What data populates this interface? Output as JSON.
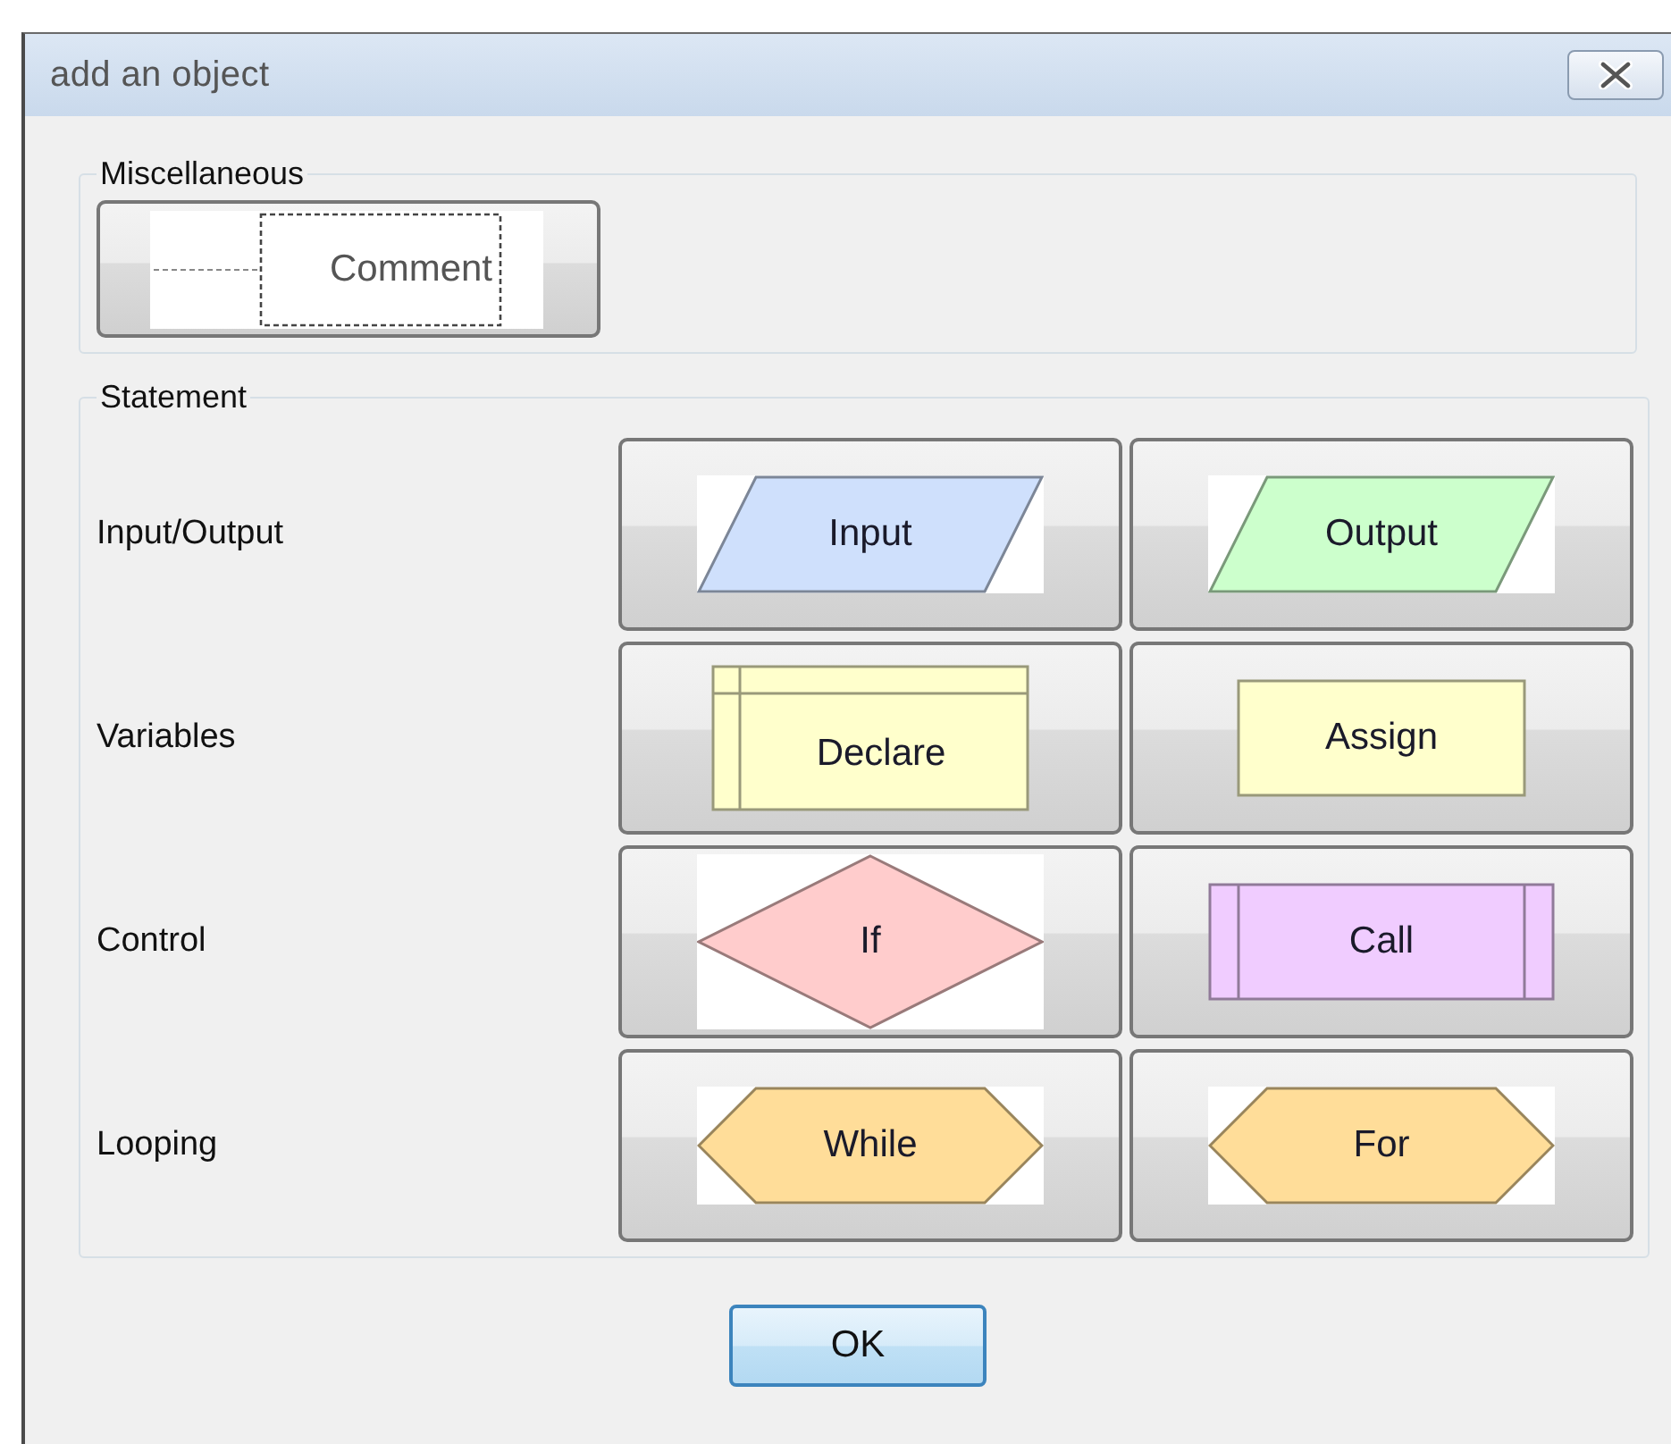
{
  "window": {
    "title": "add an object"
  },
  "miscellaneous": {
    "title": "Miscellaneous",
    "objects": [
      {
        "label": "Comment",
        "kind": "comment"
      }
    ]
  },
  "statement": {
    "title": "Statement",
    "rows": [
      {
        "label": "Input/Output",
        "objects": [
          {
            "label": "Input",
            "kind": "parallelogram",
            "color": "#cfe0fc"
          },
          {
            "label": "Output",
            "kind": "parallelogram",
            "color": "#ccffcc"
          }
        ]
      },
      {
        "label": "Variables",
        "objects": [
          {
            "label": "Declare",
            "kind": "declare",
            "color": "#ffffcc"
          },
          {
            "label": "Assign",
            "kind": "rectangle",
            "color": "#ffffcc"
          }
        ]
      },
      {
        "label": "Control",
        "objects": [
          {
            "label": "If",
            "kind": "diamond",
            "color": "#ffcccc"
          },
          {
            "label": "Call",
            "kind": "call",
            "color": "#f0ccff"
          }
        ]
      },
      {
        "label": "Looping",
        "objects": [
          {
            "label": "While",
            "kind": "hexagon",
            "color": "#ffdd99"
          },
          {
            "label": "For",
            "kind": "hexagon",
            "color": "#ffdd99"
          }
        ]
      }
    ]
  },
  "buttons": [
    {
      "label": "OK"
    }
  ]
}
